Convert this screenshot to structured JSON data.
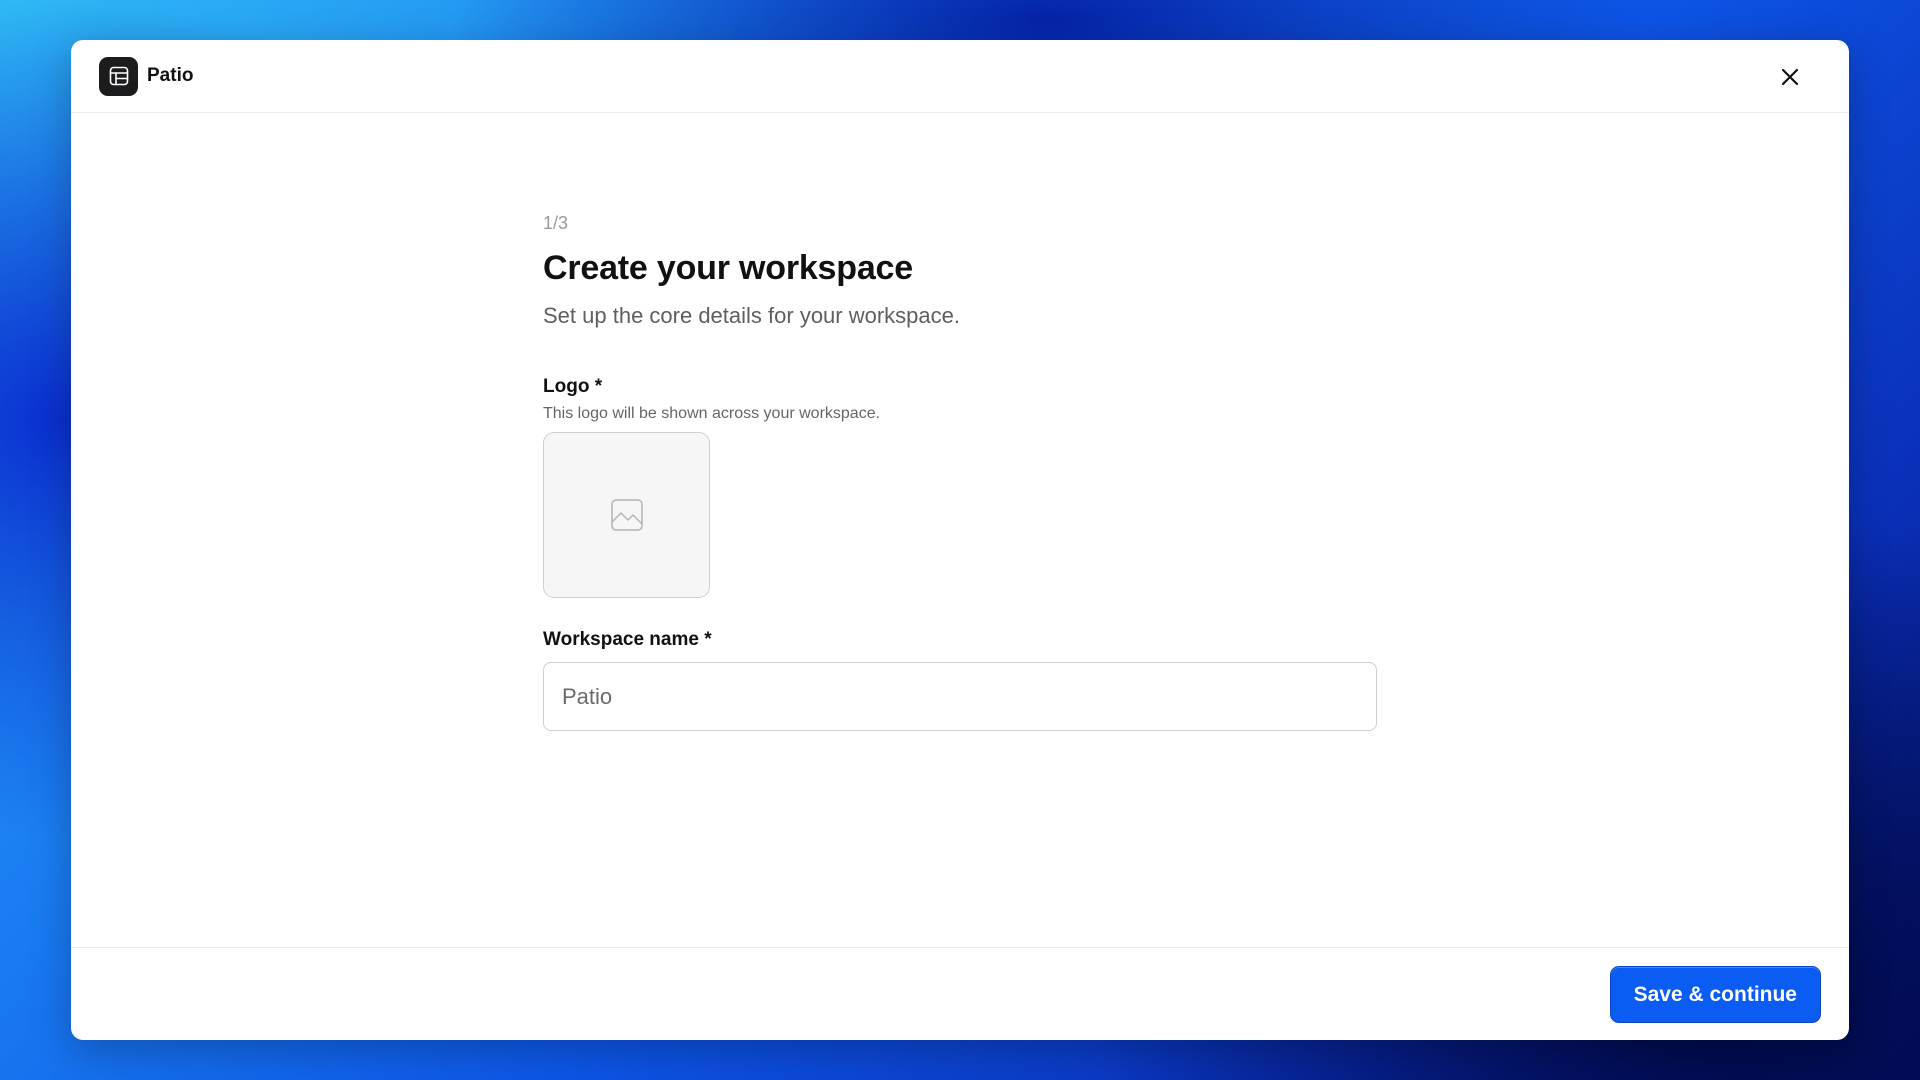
{
  "app": {
    "name": "Patio",
    "logo_icon": "patio-logo-icon",
    "close_icon": "close-icon"
  },
  "wizard": {
    "step": "1/3",
    "title": "Create your workspace",
    "subtitle": "Set up the core details for your workspace.",
    "logo_field": {
      "label": "Logo *",
      "help": "This logo will be shown across your workspace.",
      "icon": "image-placeholder-icon"
    },
    "name_field": {
      "label": "Workspace name *",
      "placeholder": "Patio"
    }
  },
  "footer": {
    "primary_label": "Save & continue"
  },
  "colors": {
    "primary": "#0a5cf2",
    "logo_bg": "#1c1c1e"
  }
}
